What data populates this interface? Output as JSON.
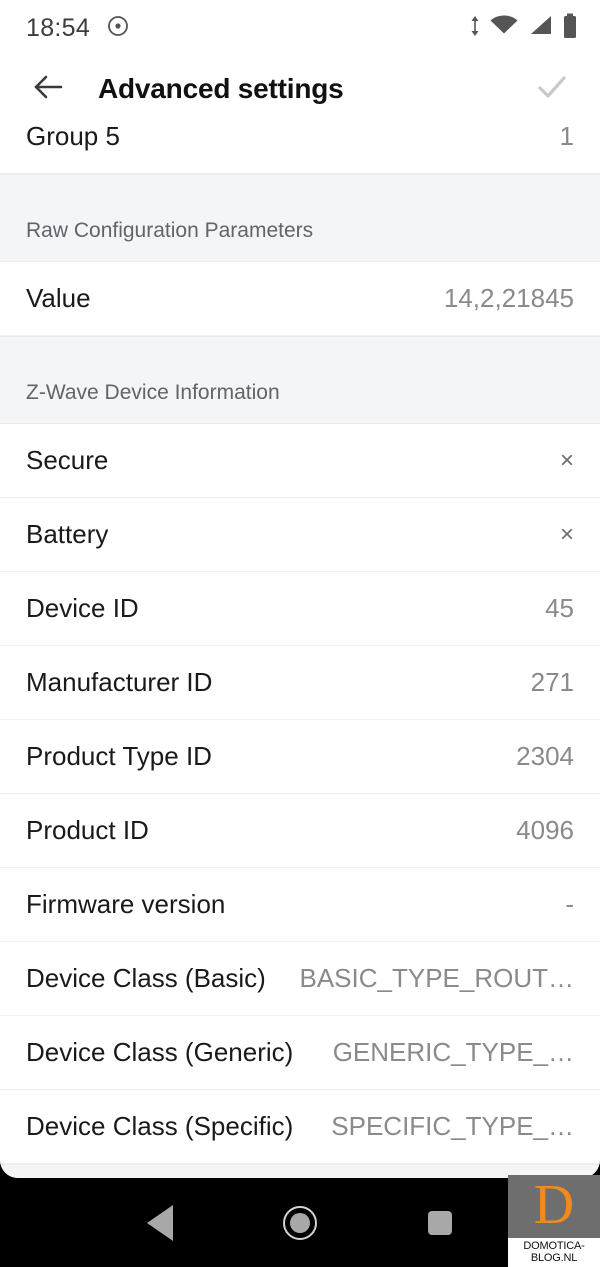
{
  "status_bar": {
    "time": "18:54",
    "icons": [
      "circle-dot-icon",
      "data-transfer-icon",
      "wifi-icon",
      "cell-signal-icon",
      "battery-icon"
    ]
  },
  "app_bar": {
    "back_icon": "arrow-left-icon",
    "title": "Advanced settings",
    "confirm_icon": "check-icon"
  },
  "list": [
    {
      "type": "row",
      "label": "Group 5",
      "value": "1",
      "clipped": true
    },
    {
      "type": "section",
      "label": "Raw Configuration Parameters"
    },
    {
      "type": "row",
      "label": "Value",
      "value": "14,2,21845"
    },
    {
      "type": "section",
      "label": "Z-Wave Device Information"
    },
    {
      "type": "row",
      "label": "Secure",
      "value": "×",
      "mark": true
    },
    {
      "type": "row",
      "label": "Battery",
      "value": "×",
      "mark": true
    },
    {
      "type": "row",
      "label": "Device ID",
      "value": "45"
    },
    {
      "type": "row",
      "label": "Manufacturer ID",
      "value": "271"
    },
    {
      "type": "row",
      "label": "Product Type ID",
      "value": "2304"
    },
    {
      "type": "row",
      "label": "Product ID",
      "value": "4096"
    },
    {
      "type": "row",
      "label": "Firmware version",
      "value": "-"
    },
    {
      "type": "row",
      "label": "Device Class (Basic)",
      "value": "BASIC_TYPE_ROUT…",
      "truncate": true
    },
    {
      "type": "row",
      "label": "Device Class (Generic)",
      "value": "GENERIC_TYPE_…",
      "truncate": true
    },
    {
      "type": "row",
      "label": "Device Class (Specific)",
      "value": "SPECIFIC_TYPE_…",
      "truncate": true
    }
  ],
  "nav_bar": {
    "back_label": "back-button",
    "home_label": "home-button",
    "recents_label": "recents-button"
  },
  "watermark": {
    "letter": "D",
    "label": "DOMOTICA-BLOG.NL",
    "accent_color": "#f08a1a"
  }
}
